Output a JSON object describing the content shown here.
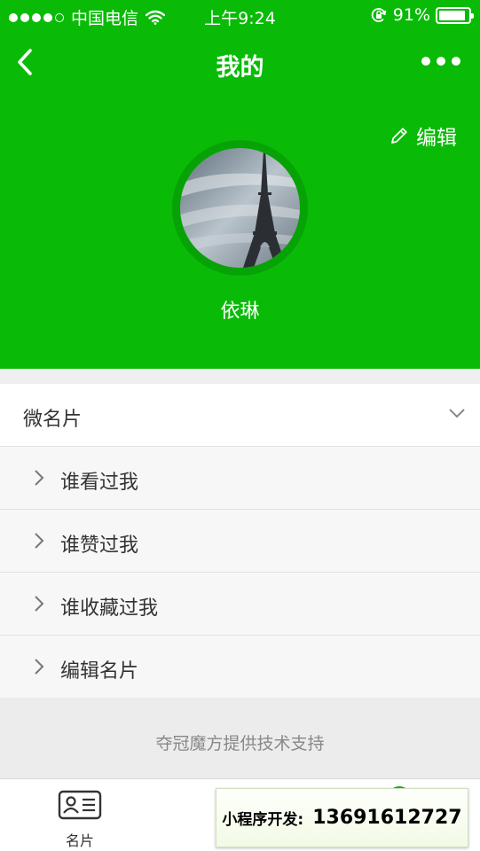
{
  "status_bar": {
    "carrier": "中国电信",
    "time": "上午9:24",
    "battery": "91%",
    "battery_level": 0.91
  },
  "navbar": {
    "title": "我的",
    "back_icon": "chevron-left-icon",
    "more_icon": "ellipsis-icon"
  },
  "profile": {
    "edit_label": "编辑",
    "edit_icon": "pencil-icon",
    "name": "依琳"
  },
  "card": {
    "title": "微名片",
    "items": [
      {
        "label": "谁看过我"
      },
      {
        "label": "谁赞过我"
      },
      {
        "label": "谁收藏过我"
      },
      {
        "label": "编辑名片"
      }
    ]
  },
  "footer_note": "夺冠魔方提供技术支持",
  "tabbar": {
    "tabs": [
      {
        "label": "名片",
        "icon": "business-card-icon"
      }
    ]
  },
  "promo": {
    "label": "小程序开发:",
    "phone": "13691612727"
  },
  "colors": {
    "brand": "#09bb07",
    "ring": "#07a306"
  }
}
